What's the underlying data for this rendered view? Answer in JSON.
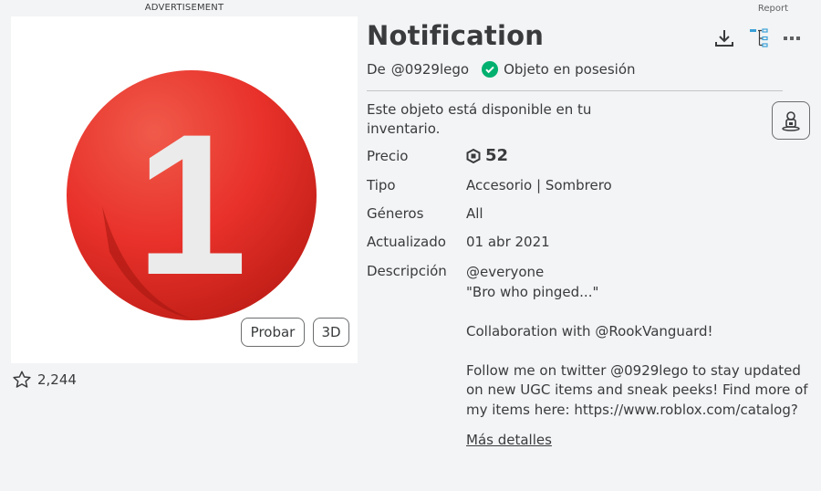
{
  "ad": {
    "label": "ADVERTISEMENT"
  },
  "report": {
    "label": "Report"
  },
  "thumbnail": {
    "try_label": "Probar",
    "view3d_label": "3D",
    "glyph": "1"
  },
  "favorites": {
    "count": "2,244"
  },
  "item": {
    "title": "Notification",
    "by_prefix": "De",
    "creator": "@0929lego",
    "owned_label": "Objeto en posesión",
    "owned_message": "Este objeto está disponible en tu inventario."
  },
  "details": {
    "price_label": "Precio",
    "price_value": "52",
    "type_label": "Tipo",
    "type_value": "Accesorio | Sombrero",
    "genres_label": "Géneros",
    "genres_value": "All",
    "updated_label": "Actualizado",
    "updated_value": "01 abr 2021",
    "description_label": "Descripción",
    "description_lines": {
      "l1": "@everyone",
      "l2": "\"Bro who pinged...\"",
      "l3": "Collaboration with @RookVanguard!",
      "l4": "Follow me on twitter @0929lego to stay updated on new UGC items and sneak peeks! Find more of my items here: ",
      "l4_link": "https://www.roblox.com/catalog?"
    },
    "more_details": "Más detalles"
  },
  "colors": {
    "background": "#f2f4f5",
    "text": "#393b3d",
    "badge_red": "#e8312a",
    "owned_green": "#00b06f"
  },
  "icons": [
    "download-icon",
    "hierarchy-icon",
    "more-options-icon",
    "verified-check-icon",
    "wear-avatar-icon",
    "star-icon",
    "robux-icon"
  ]
}
